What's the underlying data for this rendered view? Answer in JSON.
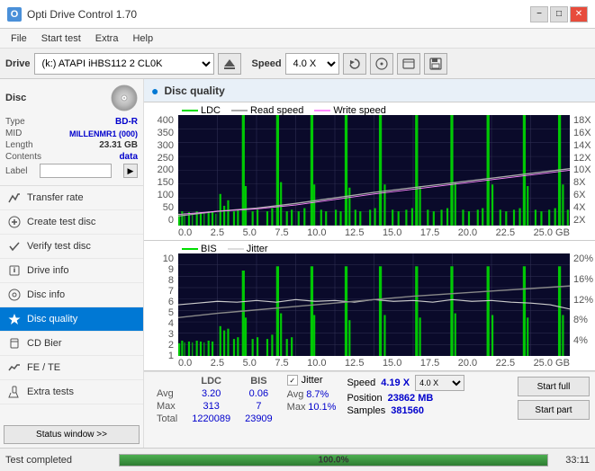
{
  "app": {
    "title": "Opti Drive Control 1.70",
    "icon_label": "O"
  },
  "title_controls": {
    "minimize": "−",
    "maximize": "□",
    "close": "✕"
  },
  "menu": {
    "items": [
      "File",
      "Start test",
      "Extra",
      "Help"
    ]
  },
  "toolbar": {
    "drive_label": "Drive",
    "drive_value": "(k:) ATAPI iHBS112  2 CL0K",
    "speed_label": "Speed",
    "speed_value": "4.0 X"
  },
  "disc": {
    "title": "Disc",
    "type_label": "Type",
    "type_value": "BD-R",
    "mid_label": "MID",
    "mid_value": "MILLENMR1 (000)",
    "length_label": "Length",
    "length_value": "23.31 GB",
    "contents_label": "Contents",
    "contents_value": "data",
    "label_label": "Label",
    "label_value": ""
  },
  "nav": {
    "items": [
      {
        "id": "transfer-rate",
        "label": "Transfer rate",
        "icon": "📊"
      },
      {
        "id": "create-test-disc",
        "label": "Create test disc",
        "icon": "💿"
      },
      {
        "id": "verify-test-disc",
        "label": "Verify test disc",
        "icon": "✔"
      },
      {
        "id": "drive-info",
        "label": "Drive info",
        "icon": "ℹ"
      },
      {
        "id": "disc-info",
        "label": "Disc info",
        "icon": "📄"
      },
      {
        "id": "disc-quality",
        "label": "Disc quality",
        "icon": "★",
        "active": true
      },
      {
        "id": "cd-bier",
        "label": "CD Bier",
        "icon": "🍺"
      },
      {
        "id": "fe-te",
        "label": "FE / TE",
        "icon": "📈"
      },
      {
        "id": "extra-tests",
        "label": "Extra tests",
        "icon": "🔬"
      }
    ],
    "status_window_label": "Status window >>"
  },
  "content": {
    "title": "Disc quality",
    "icon": "●"
  },
  "chart_top": {
    "legend": [
      {
        "label": "LDC",
        "color": "#00cc00"
      },
      {
        "label": "Read speed",
        "color": "#aaaaaa"
      },
      {
        "label": "Write speed",
        "color": "#ff88ff"
      }
    ],
    "y_left": [
      "400",
      "350",
      "300",
      "250",
      "200",
      "150",
      "100",
      "50",
      "0"
    ],
    "y_right": [
      "18X",
      "16X",
      "14X",
      "12X",
      "10X",
      "8X",
      "6X",
      "4X",
      "2X",
      ""
    ],
    "x_labels": [
      "0.0",
      "2.5",
      "5.0",
      "7.5",
      "10.0",
      "12.5",
      "15.0",
      "17.5",
      "20.0",
      "22.5",
      "25.0 GB"
    ]
  },
  "chart_bottom": {
    "legend": [
      {
        "label": "BIS",
        "color": "#00cc00"
      },
      {
        "label": "Jitter",
        "color": "#aaaaaa"
      }
    ],
    "y_left": [
      "10",
      "9",
      "8",
      "7",
      "6",
      "5",
      "4",
      "3",
      "2",
      "1"
    ],
    "y_right": [
      "20%",
      "16%",
      "12%",
      "8%",
      "4%",
      ""
    ],
    "x_labels": [
      "0.0",
      "2.5",
      "5.0",
      "7.5",
      "10.0",
      "12.5",
      "15.0",
      "17.5",
      "20.0",
      "22.5",
      "25.0 GB"
    ]
  },
  "stats": {
    "headers": [
      "LDC",
      "BIS"
    ],
    "rows": [
      {
        "label": "Avg",
        "ldc": "3.20",
        "bis": "0.06"
      },
      {
        "label": "Max",
        "ldc": "313",
        "bis": "7"
      },
      {
        "label": "Total",
        "ldc": "1220089",
        "bis": "23909"
      }
    ],
    "jitter_label": "Jitter",
    "jitter_checked": true,
    "jitter_avg": "8.7%",
    "jitter_max": "10.1%",
    "speed_label": "Speed",
    "speed_value": "4.19 X",
    "speed_select": "4.0 X",
    "position_label": "Position",
    "position_value": "23862 MB",
    "samples_label": "Samples",
    "samples_value": "381560",
    "start_full_label": "Start full",
    "start_part_label": "Start part"
  },
  "status_bar": {
    "text": "Test completed",
    "progress": 100,
    "progress_text": "100.0%",
    "time": "33:11"
  },
  "colors": {
    "accent": "#0078d4",
    "ldc_green": "#00dd00",
    "speed_gray": "#cccccc",
    "write_pink": "#ff88ff",
    "jitter_white": "#ffffff",
    "grid_line": "#dddddd",
    "bg_chart": "#111133"
  }
}
